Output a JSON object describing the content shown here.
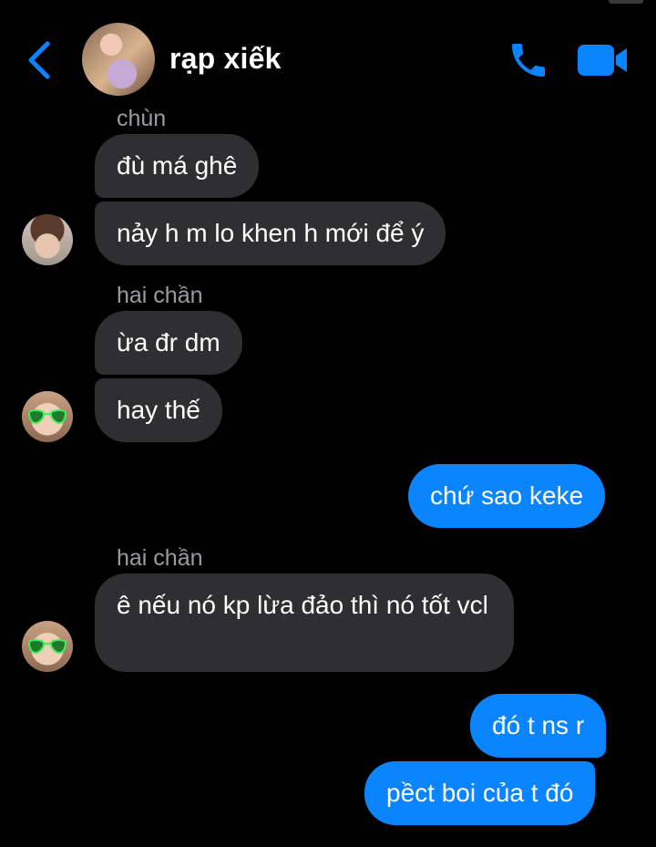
{
  "header": {
    "title": "rạp xiếk",
    "back_icon": "chevron-left-icon",
    "call_icon": "phone-icon",
    "video_icon": "video-camera-icon",
    "accent": "#0a84ff"
  },
  "messages": [
    {
      "sender": "chùn",
      "texts": [
        "đù má ghê",
        "nảy h m lo khen h mới để ý"
      ]
    },
    {
      "sender": "hai chần",
      "texts": [
        "ừa đr dm",
        "hay thế"
      ]
    },
    {
      "sender": "me",
      "texts": [
        "chứ sao keke"
      ]
    },
    {
      "sender": "hai chần",
      "texts": [
        "ê nếu nó kp lừa đảo thì nó tốt vcl"
      ]
    },
    {
      "sender": "me",
      "texts": [
        "đó t ns r",
        "pềct boi của t đó"
      ]
    }
  ],
  "colors": {
    "incoming_bubble": "#2f2f31",
    "outgoing_bubble": "#0a84ff",
    "sender_name": "#9b9ba1"
  }
}
